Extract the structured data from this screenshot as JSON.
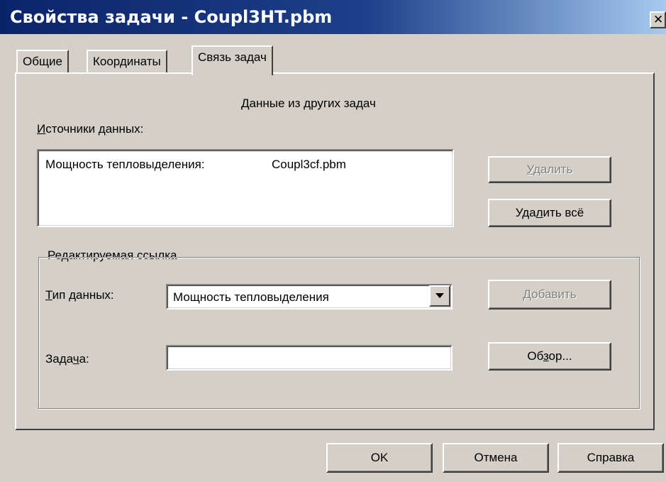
{
  "window": {
    "title": "Свойства задачи - Coupl3HT.pbm",
    "close_glyph": "✕"
  },
  "tabs": [
    {
      "label": "Общие",
      "active": false
    },
    {
      "label": "Координаты",
      "active": false
    },
    {
      "label": "Связь задач",
      "active": true
    }
  ],
  "panel": {
    "heading": "Данные из других задач",
    "sources_label_accel": "И",
    "sources_label_rest": "сточники данных:",
    "sources": [
      {
        "type": "Мощность тепловыделения:",
        "task": "Coupl3cf.pbm"
      }
    ],
    "delete_accel": "У",
    "delete_rest": "далить",
    "delete_all_pre": "Уда",
    "delete_all_accel": "л",
    "delete_all_post": "ить всё"
  },
  "group": {
    "title": "Редактируемая ссылка",
    "datatype_accel": "Т",
    "datatype_rest": "ип данных:",
    "datatype_value": "Мощность тепловыделения",
    "add_accel": "Д",
    "add_rest": "обавить",
    "task_pre": "Зада",
    "task_accel": "ч",
    "task_post": "а:",
    "task_value": "",
    "browse_pre": "Об",
    "browse_accel": "з",
    "browse_post": "ор..."
  },
  "footer": {
    "ok_label": "OK",
    "cancel_label": "Отмена",
    "help_label": "Справка"
  }
}
